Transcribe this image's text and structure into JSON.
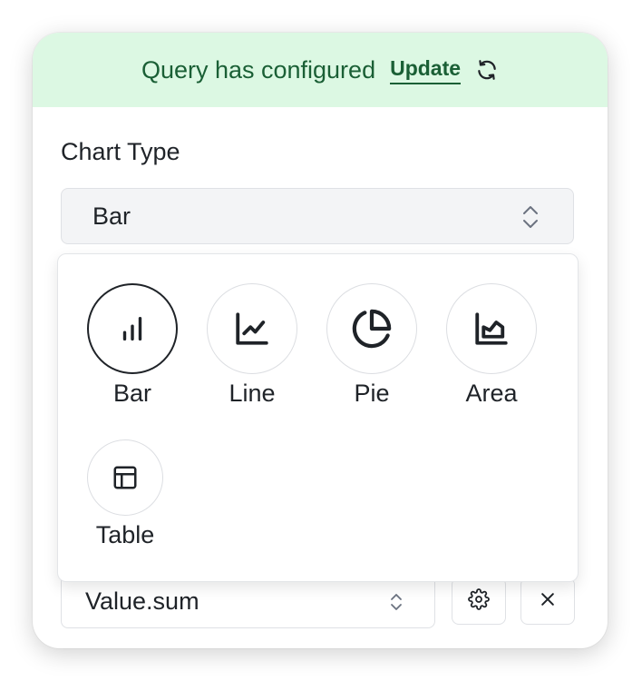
{
  "banner": {
    "message": "Query has configured",
    "update_label": "Update",
    "refresh_icon": "refresh-icon",
    "background": "#dcf8e3",
    "text_color": "#1a5f35"
  },
  "chart_type": {
    "label": "Chart Type",
    "selected_value": "Bar",
    "options": [
      {
        "label": "Bar",
        "icon": "bar-chart-icon",
        "selected": true
      },
      {
        "label": "Line",
        "icon": "line-chart-icon",
        "selected": false
      },
      {
        "label": "Pie",
        "icon": "pie-chart-icon",
        "selected": false
      },
      {
        "label": "Area",
        "icon": "area-chart-icon",
        "selected": false
      },
      {
        "label": "Table",
        "icon": "table-icon",
        "selected": false
      }
    ]
  },
  "value_field": {
    "value": "Value.sum",
    "settings_icon": "gear-icon",
    "remove_icon": "close-icon"
  }
}
